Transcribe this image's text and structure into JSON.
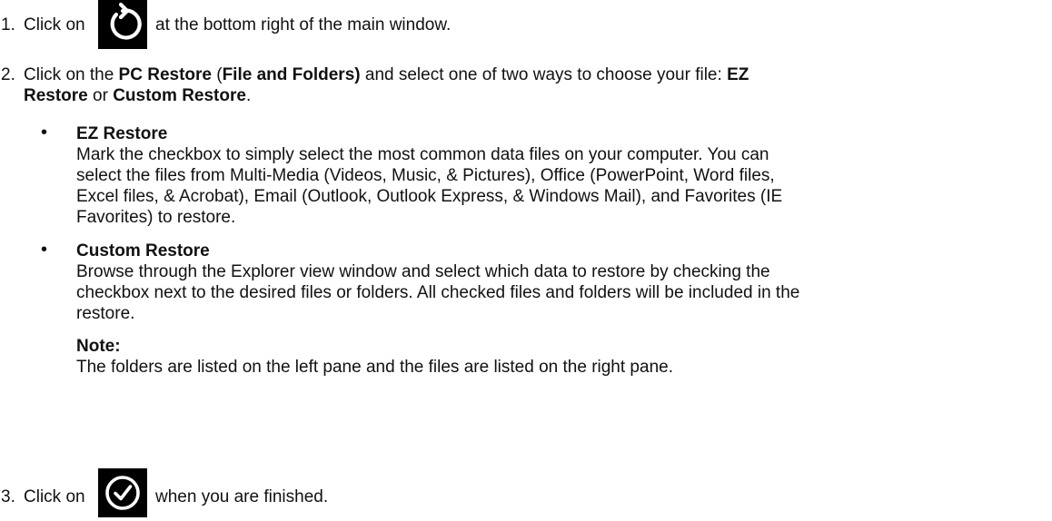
{
  "steps": [
    {
      "number": "1.",
      "prefix": "Click on",
      "icon": "restore-icon",
      "suffix": "at the bottom right of the main window."
    },
    {
      "number": "2.",
      "text1": "Click on the ",
      "bold1": "PC Restore",
      "text2": " (",
      "bold2": "File and Folders)",
      "text3": " and select one of two ways to choose your file: ",
      "bold3a": "EZ",
      "bold3b": "Restore",
      "text4": " or ",
      "bold4": "Custom Restore",
      "text5": "."
    },
    {
      "number": "3.",
      "prefix": "Click on",
      "icon": "checkmark-icon",
      "suffix": "when you are finished."
    }
  ],
  "bullets": [
    {
      "symbol": "•",
      "title": "EZ Restore",
      "lines": [
        "Mark the checkbox to simply select the most common data files on your computer. You can",
        "select the files from Multi-Media (Videos, Music, & Pictures), Office (PowerPoint, Word files,",
        "Excel files, & Acrobat), Email (Outlook, Outlook Express, & Windows Mail), and Favorites (IE",
        "Favorites) to restore."
      ]
    },
    {
      "symbol": "•",
      "title": "Custom Restore",
      "lines": [
        "Browse through the Explorer view window and select which data to restore by checking the",
        "checkbox next to the desired files or folders. All checked files and folders will be included in the",
        "restore."
      ]
    }
  ],
  "note": {
    "title": "Note:",
    "text": "The folders are listed on the left pane and the files are listed on the right pane."
  }
}
